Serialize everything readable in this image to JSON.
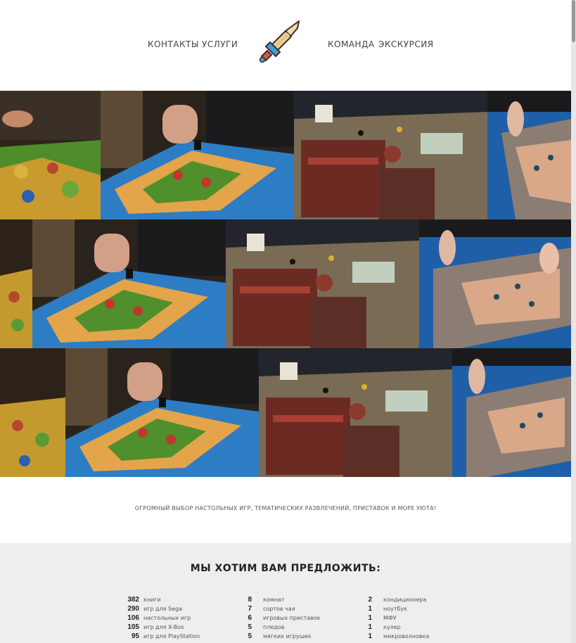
{
  "nav": {
    "left": [
      "КОНТАКТЫ",
      "УСЛУГИ"
    ],
    "right": [
      "КОМАНДА",
      "ЭКСКУРСИЯ"
    ],
    "logo_icon": "sword-icon"
  },
  "gallery": {
    "photos": [
      "catan-board-photo",
      "board-game-table-photo",
      "miniatures-board-photo"
    ]
  },
  "tagline": "ОГРОМНЫЙ ВЫБОР НАСТОЛЬНЫХ ИГР, ТЕМАТИЧЕСКИХ РАЗВЛЕЧЕНИЙ, ПРИСТАВОК И МОРЕ УЮТА!",
  "offer": {
    "title": "МЫ ХОТИМ ВАМ ПРЕДЛОЖИТЬ:",
    "columns": [
      [
        {
          "num": "382",
          "label": "книги"
        },
        {
          "num": "290",
          "label": "игр для Sega"
        },
        {
          "num": "106",
          "label": "настольных игр"
        },
        {
          "num": "105",
          "label": "игр для X-Box"
        },
        {
          "num": "95",
          "label": "игр для PlayStation"
        }
      ],
      [
        {
          "num": "8",
          "label": "комнат"
        },
        {
          "num": "7",
          "label": "сортов чая"
        },
        {
          "num": "6",
          "label": "игровых приставок"
        },
        {
          "num": "5",
          "label": "пледов"
        },
        {
          "num": "5",
          "label": "мягких игрушек"
        }
      ],
      [
        {
          "num": "2",
          "label": "кондиционера"
        },
        {
          "num": "1",
          "label": "ноутбук"
        },
        {
          "num": "1",
          "label": "МФУ"
        },
        {
          "num": "1",
          "label": "кулер"
        },
        {
          "num": "1",
          "label": "микроволновка"
        }
      ]
    ]
  },
  "colors": {
    "background": "#ffffff",
    "offer_background": "#eeeeee",
    "logo_blade": "#f3d9a6",
    "logo_hilt": "#3f9fd8"
  }
}
